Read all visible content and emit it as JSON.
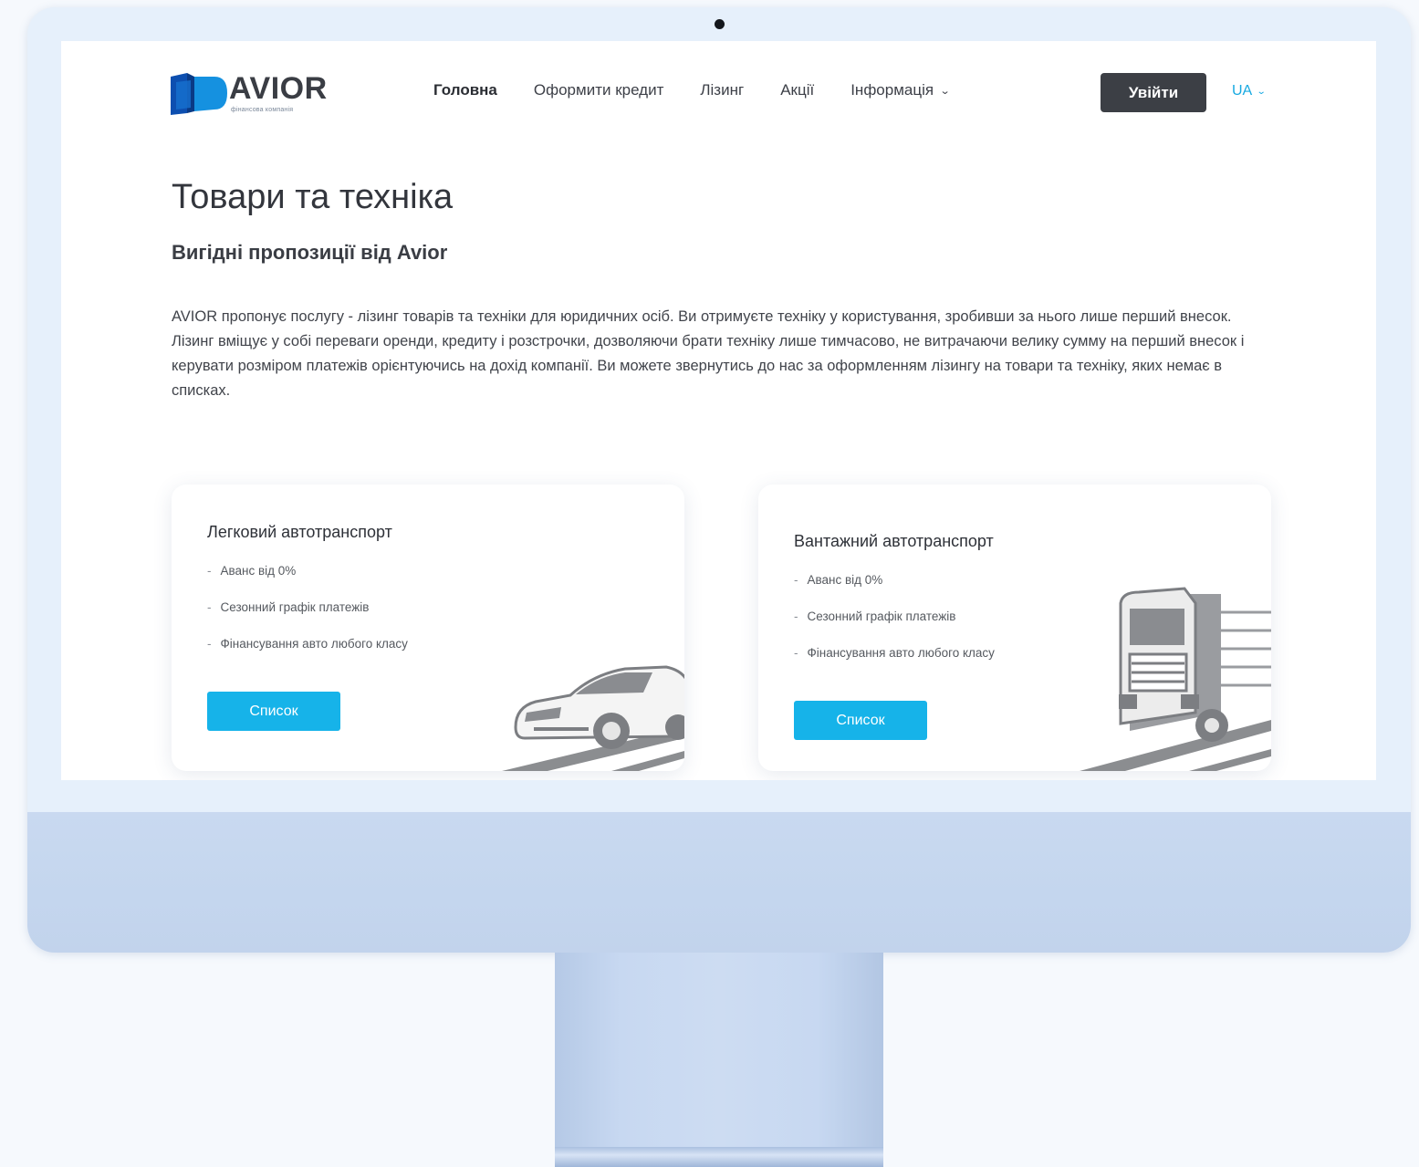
{
  "header": {
    "logo_text": "AVIOR",
    "logo_tagline": "фінансова компанія",
    "nav": [
      {
        "label": "Головна"
      },
      {
        "label": "Оформити кредит"
      },
      {
        "label": "Лізинг"
      },
      {
        "label": "Акції"
      },
      {
        "label": "Інформація"
      }
    ],
    "login_label": "Увійти",
    "lang_label": "UA"
  },
  "main": {
    "title": "Товари та техніка",
    "subtitle": "Вигідні пропозиції від Avior",
    "description": "AVIOR пропонує послугу - лізинг товарів та техніки для юридичних осіб. Ви отримуєте техніку у користування, зробивши за нього лише перший внесок. Лізинг вміщує у собі переваги оренди, кредиту і розстрочки, дозволяючи брати техніку лише тимчасово, не витрачаючи велику сумму на перший внесок і керувати розміром платежів орієнтуючись на дохід компанії. Ви можете звернутись до нас за оформленням лізингу на товари та техніку, яких немає в списках."
  },
  "cards": [
    {
      "title": "Легковий автотранспорт",
      "features": [
        "Аванс від 0%",
        "Сезонний графік платежів",
        "Фінансування авто любого класу"
      ],
      "button_label": "Список",
      "image_icon": "car-icon"
    },
    {
      "title": "Вантажний автотранспорт",
      "features": [
        "Аванс від 0%",
        "Сезонний графік платежів",
        "Фінансування авто любого класу"
      ],
      "button_label": "Список",
      "image_icon": "truck-icon"
    }
  ],
  "colors": {
    "accent": "#16b3e9",
    "dark_button": "#3c3f45",
    "text": "#33363d"
  }
}
